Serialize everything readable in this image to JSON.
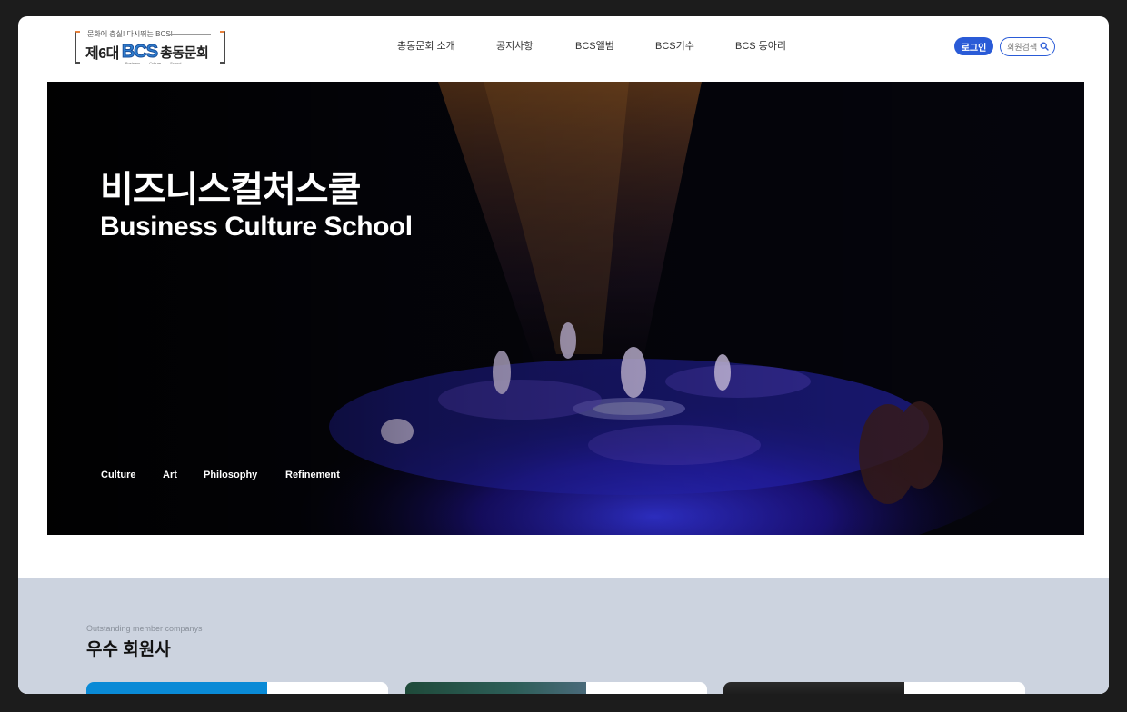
{
  "logo": {
    "tagline": "문화에 충실! 다시뛰는 BCS!",
    "part_a": "제6대",
    "part_bcs": "BCS",
    "part_b": "총동문회",
    "sub": [
      "Business",
      "Culture",
      "School"
    ]
  },
  "nav": {
    "items": [
      {
        "label": "총동문회 소개"
      },
      {
        "label": "공지사항"
      },
      {
        "label": "BCS앨범"
      },
      {
        "label": "BCS기수"
      },
      {
        "label": "BCS 동아리"
      }
    ]
  },
  "auth": {
    "login_label": "로그인",
    "search_placeholder": "회원검색",
    "search_icon": "search-icon"
  },
  "hero": {
    "title_kr": "비즈니스컬처스쿨",
    "title_en": "Business Culture School",
    "keywords": [
      "Culture",
      "Art",
      "Philosophy",
      "Refinement"
    ]
  },
  "members": {
    "subtitle": "Outstanding member companys",
    "title": "우수 회원사"
  },
  "colors": {
    "accent": "#2a5bd7",
    "section_bg": "#ccd3df",
    "frame_bg": "#1c1c1c"
  }
}
